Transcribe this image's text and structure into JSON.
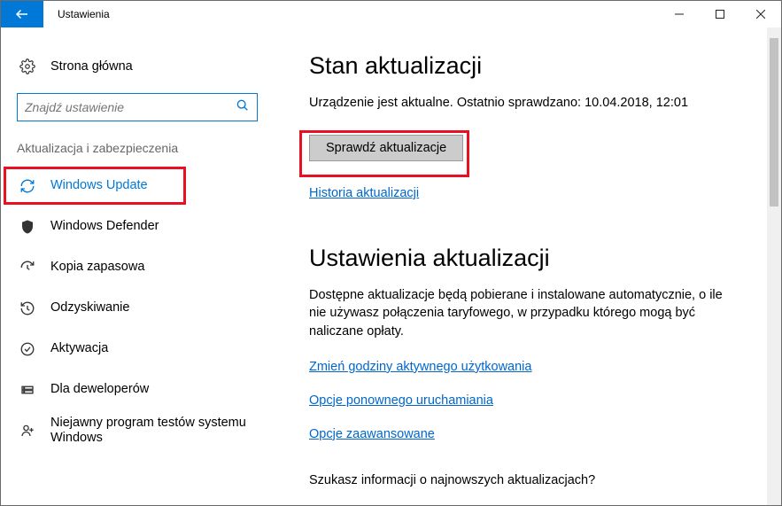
{
  "window": {
    "title": "Ustawienia"
  },
  "sidebar": {
    "home": "Strona główna",
    "search_placeholder": "Znajdź ustawienie",
    "section": "Aktualizacja i zabezpieczenia",
    "items": [
      {
        "label": "Windows Update"
      },
      {
        "label": "Windows Defender"
      },
      {
        "label": "Kopia zapasowa"
      },
      {
        "label": "Odzyskiwanie"
      },
      {
        "label": "Aktywacja"
      },
      {
        "label": "Dla deweloperów"
      },
      {
        "label": "Niejawny program testów systemu Windows"
      }
    ]
  },
  "main": {
    "status_heading": "Stan aktualizacji",
    "status_text": "Urządzenie jest aktualne. Ostatnio sprawdzano: 10.04.2018, 12:01",
    "check_button": "Sprawdź aktualizacje",
    "history_link": "Historia aktualizacji",
    "settings_heading": "Ustawienia aktualizacji",
    "settings_para": "Dostępne aktualizacje będą pobierane i instalowane automatycznie, o ile nie używasz połączenia taryfowego, w przypadku którego mogą być naliczane opłaty.",
    "links": {
      "active_hours": "Zmień godziny aktywnego użytkowania",
      "restart_options": "Opcje ponownego uruchamiania",
      "advanced": "Opcje zaawansowane"
    },
    "footer_question": "Szukasz informacji o najnowszych aktualizacjach?"
  }
}
